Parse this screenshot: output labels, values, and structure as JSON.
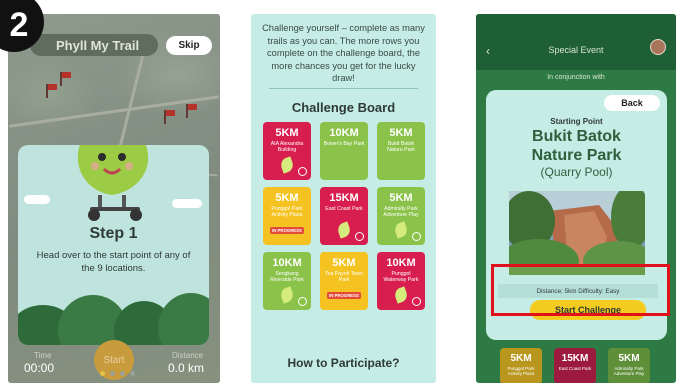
{
  "step_badge": "2",
  "intro_screen": {
    "title": "Phyll My Trail",
    "skip_label": "Skip",
    "step_title": "Step 1",
    "step_desc": "Head over to the start point of any of the 9 locations.",
    "time_label": "Time",
    "time_value": "00:00",
    "start_label": "Start",
    "distance_label": "Distance",
    "distance_value": "0.0 km",
    "page_dots": 4,
    "active_dot": 0
  },
  "board_screen": {
    "intro": "Challenge yourself – complete as many trails as you can. The more rows you complete on the challenge board, the more chances you get for the lucky draw!",
    "title": "Challenge Board",
    "tiles": [
      {
        "km": "5KM",
        "name": "AIA Alexandra Building",
        "color": "red",
        "status": "done"
      },
      {
        "km": "10KM",
        "name": "Bower's Bay Park",
        "color": "green",
        "status": "none"
      },
      {
        "km": "5KM",
        "name": "Bukit Batok Nature Park",
        "color": "green",
        "status": "none"
      },
      {
        "km": "5KM",
        "name": "Punggol Park Activity Plaza",
        "color": "yellow",
        "status": "IN PROGRESS"
      },
      {
        "km": "15KM",
        "name": "East Coast Park",
        "color": "red",
        "status": "done"
      },
      {
        "km": "5KM",
        "name": "Admiralty Park Adventure Play",
        "color": "green",
        "status": "done"
      },
      {
        "km": "10KM",
        "name": "Sengkang Riverside Park",
        "color": "green",
        "status": "done"
      },
      {
        "km": "5KM",
        "name": "Toa Payoh Town Park",
        "color": "yellow",
        "status": "IN PROGRESS"
      },
      {
        "km": "10KM",
        "name": "Punggol Waterway Park",
        "color": "red",
        "status": "done"
      }
    ],
    "how_to": "How to Participate?"
  },
  "event_screen": {
    "header_title": "Special Event",
    "conjunction": "In conjunction with",
    "back_label": "Back",
    "starting_point": "Starting Point",
    "park_name_line1": "Bukit Batok",
    "park_name_line2": "Nature Park",
    "park_sub": "(Quarry Pool)",
    "distance_text": "Distance: 5km    Difficulty: Easy",
    "start_label": "Start Challenge",
    "bottom_tiles": [
      {
        "km": "5KM",
        "name": "Punggol Park Activity Plaza",
        "color": "yellow"
      },
      {
        "km": "15KM",
        "name": "East Coast Park",
        "color": "red"
      },
      {
        "km": "5KM",
        "name": "Admiralty Park Adventure Play",
        "color": "green"
      }
    ]
  },
  "colors": {
    "red": "#d81e4f",
    "green": "#8bc34a",
    "yellow": "#f4c321",
    "highlight": "#e2101a",
    "card_bg": "#c5ece5"
  }
}
